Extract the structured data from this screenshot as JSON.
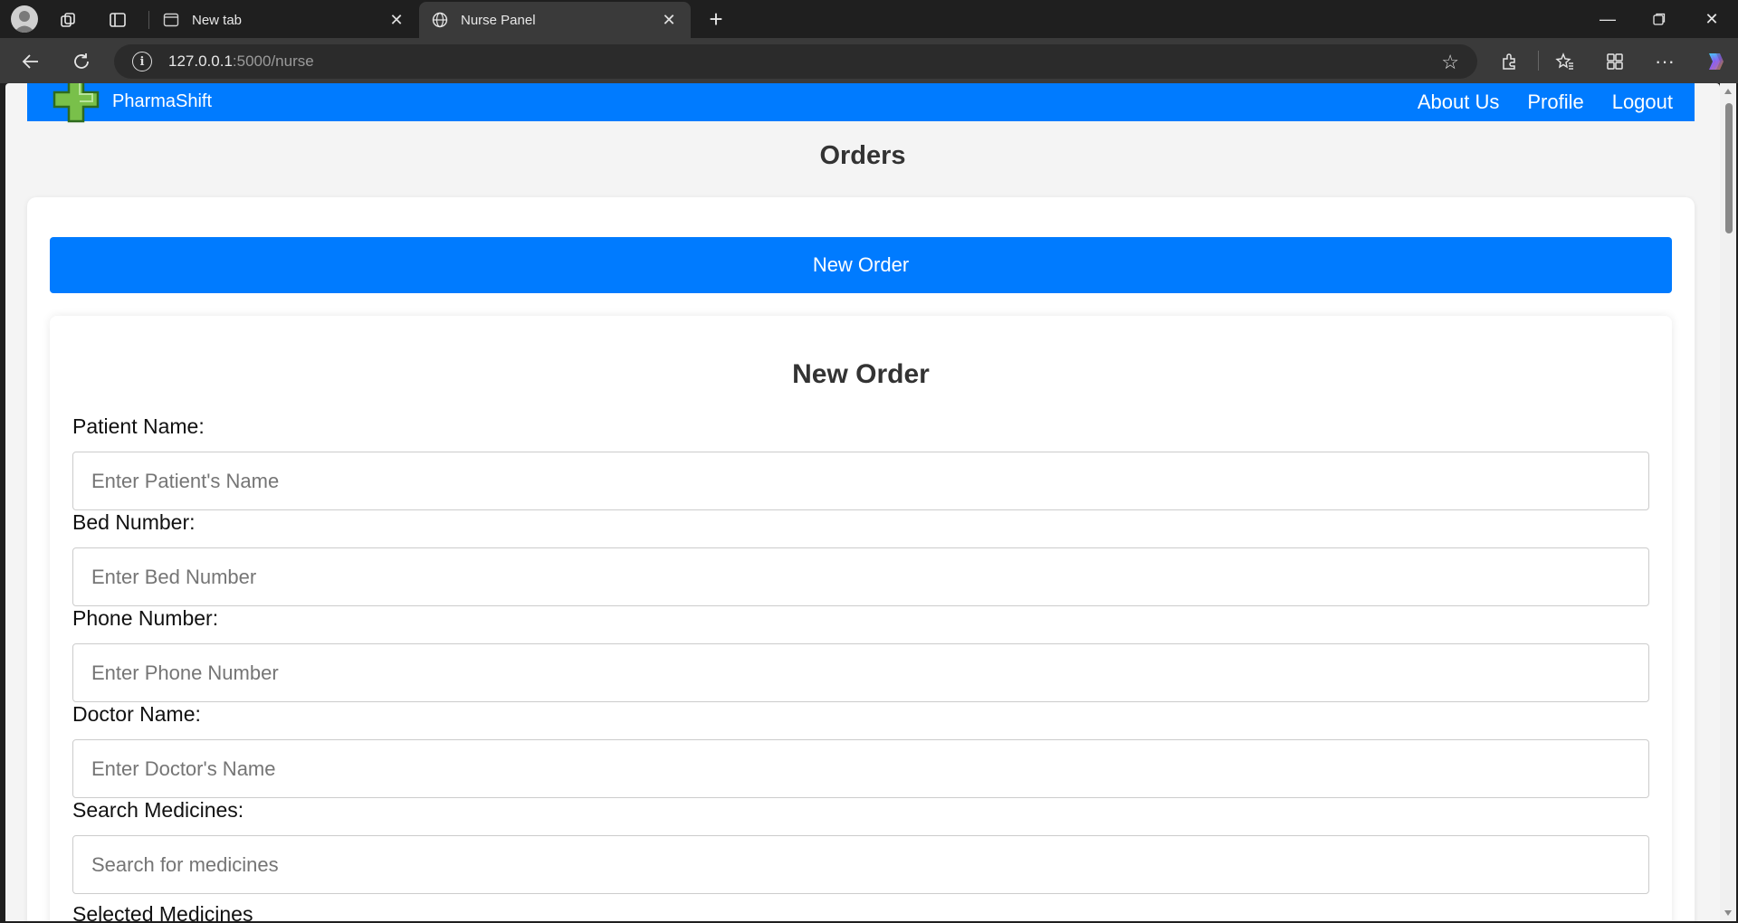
{
  "browser": {
    "tabs": [
      {
        "title": "New tab",
        "active": false
      },
      {
        "title": "Nurse Panel",
        "active": true
      }
    ],
    "url_host": "127.0.0.1",
    "url_path": ":5000/nurse"
  },
  "navbar": {
    "brand": "PharmaShift",
    "links": [
      "About Us",
      "Profile",
      "Logout"
    ],
    "color": "#007bff"
  },
  "page": {
    "title": "Orders",
    "new_order_button": "New Order"
  },
  "form": {
    "title": "New Order",
    "fields": [
      {
        "label": "Patient Name:",
        "placeholder": "Enter Patient's Name"
      },
      {
        "label": "Bed Number:",
        "placeholder": "Enter Bed Number"
      },
      {
        "label": "Phone Number:",
        "placeholder": "Enter Phone Number"
      },
      {
        "label": "Doctor Name:",
        "placeholder": "Enter Doctor's Name"
      },
      {
        "label": "Search Medicines:",
        "placeholder": "Search for medicines"
      }
    ],
    "next_label_partial": "Selected Medicines"
  }
}
